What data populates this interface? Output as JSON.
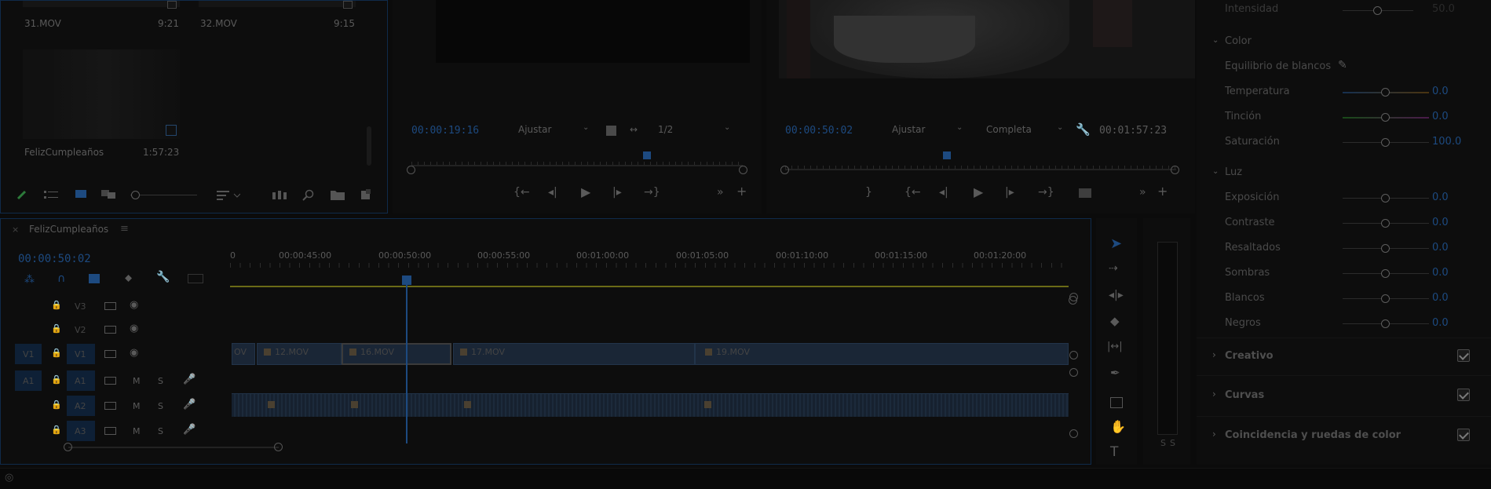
{
  "project": {
    "clips": [
      {
        "name": "31.MOV",
        "duration": "9:21"
      },
      {
        "name": "32.MOV",
        "duration": "9:15"
      },
      {
        "name": "FelizCumpleaños",
        "duration": "1:57:23"
      }
    ]
  },
  "source_monitor": {
    "timecode": "00:00:19:16",
    "fit": "Ajustar",
    "resolution": "1/2"
  },
  "program_monitor": {
    "timecode": "00:00:50:02",
    "fit": "Ajustar",
    "quality": "Completa",
    "duration": "00:01:57:23"
  },
  "timeline": {
    "sequence_name": "FelizCumpleaños",
    "playhead_time": "00:00:50:02",
    "ruler_labels": [
      "0",
      "00:00:45:00",
      "00:00:50:00",
      "00:00:55:00",
      "00:01:00:00",
      "00:01:05:00",
      "00:01:10:00",
      "00:01:15:00",
      "00:01:20:00"
    ],
    "video_tracks": [
      {
        "label": "V3"
      },
      {
        "label": "V2"
      },
      {
        "label": "V1"
      }
    ],
    "audio_tracks": [
      {
        "label": "A1",
        "m": "M",
        "s": "S"
      },
      {
        "label": "A2",
        "m": "M",
        "s": "S"
      },
      {
        "label": "A3",
        "m": "M",
        "s": "S"
      }
    ],
    "v1_clips": [
      "OV",
      "12.MOV",
      "16.MOV",
      "17.MOV",
      "19.MOV"
    ]
  },
  "audio_meter": {
    "labels": [
      "S",
      "S"
    ]
  },
  "lumetri": {
    "top_value_label": "Intensidad",
    "top_value": "50.0",
    "color_section": "Color",
    "white_balance": "Equilibrio de blancos",
    "temperature": {
      "label": "Temperatura",
      "value": "0.0"
    },
    "tint": {
      "label": "Tinción",
      "value": "0.0"
    },
    "saturation": {
      "label": "Saturación",
      "value": "100.0"
    },
    "light_section": "Luz",
    "light": [
      {
        "label": "Exposición",
        "value": "0.0"
      },
      {
        "label": "Contraste",
        "value": "0.0"
      },
      {
        "label": "Resaltados",
        "value": "0.0"
      },
      {
        "label": "Sombras",
        "value": "0.0"
      },
      {
        "label": "Blancos",
        "value": "0.0"
      },
      {
        "label": "Negros",
        "value": "0.0"
      }
    ],
    "sections": [
      {
        "label": "Creativo"
      },
      {
        "label": "Curvas"
      },
      {
        "label": "Coincidencia y ruedas de color"
      }
    ]
  },
  "colors": {
    "accent": "#2a6ad0",
    "playhead": "#3a7de0"
  }
}
